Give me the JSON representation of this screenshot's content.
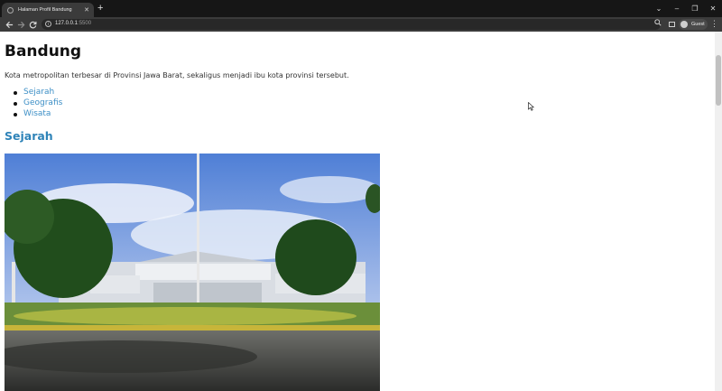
{
  "browser": {
    "tab_title": "Halaman Profil Bandung",
    "tab_close": "✕",
    "new_tab": "+",
    "address_host": "127.0.0.1",
    "address_port": ":5500",
    "profile_label": "Guest",
    "window_controls": [
      "⌄",
      "–",
      "❐",
      "✕"
    ]
  },
  "page": {
    "title": "Bandung",
    "description": "Kota metropolitan terbesar di Provinsi Jawa Barat, sekaligus menjadi ibu kota provinsi tersebut.",
    "nav_links": [
      "Sejarah",
      "Geografis",
      "Wisata"
    ],
    "section_heading": "Sejarah"
  },
  "colors": {
    "link": "#3d8fc6",
    "section_heading": "#2e83b8",
    "browser_chrome": "#3b3b3b"
  }
}
